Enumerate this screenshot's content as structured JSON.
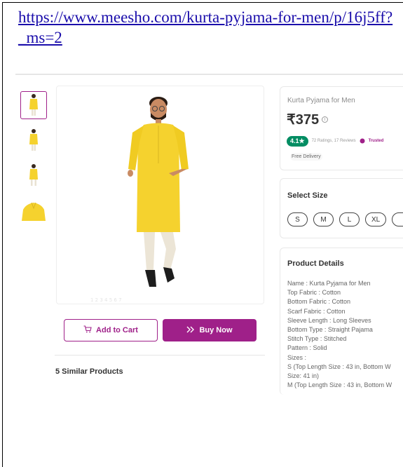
{
  "url": {
    "text": "https://www.meesho.com/kurta-pyjama-for-men/p/16j5ff?_ms=2"
  },
  "product": {
    "title": "Kurta Pyjama for Men",
    "price": "₹375",
    "rating": "4.1★",
    "ratings_reviews": "72 Ratings, 17 Reviews",
    "trusted": "Trusted",
    "delivery": "Free Delivery"
  },
  "size_section": {
    "heading": "Select Size",
    "sizes": [
      "S",
      "M",
      "L",
      "XL",
      ""
    ]
  },
  "details_section": {
    "heading": "Product Details",
    "lines": [
      "Name : Kurta Pyjama for Men",
      "Top Fabric : Cotton",
      "Bottom Fabric : Cotton",
      "Scarf Fabric : Cotton",
      "Sleeve Length : Long Sleeves",
      "Bottom Type : Straight Pajama",
      "Stitch Type : Stitched",
      "Pattern : Solid",
      "Sizes :",
      "S (Top Length Size : 43 in, Bottom W",
      "Size: 41 in)",
      "M (Top Length Size : 43 in, Bottom W"
    ]
  },
  "actions": {
    "add_to_cart": "Add to Cart",
    "buy_now": "Buy Now"
  },
  "similar": {
    "label": "5 Similar Products"
  },
  "colors": {
    "brand": "#9f2089",
    "rating_green": "#038d63",
    "kurta_yellow": "#f5d22e"
  }
}
